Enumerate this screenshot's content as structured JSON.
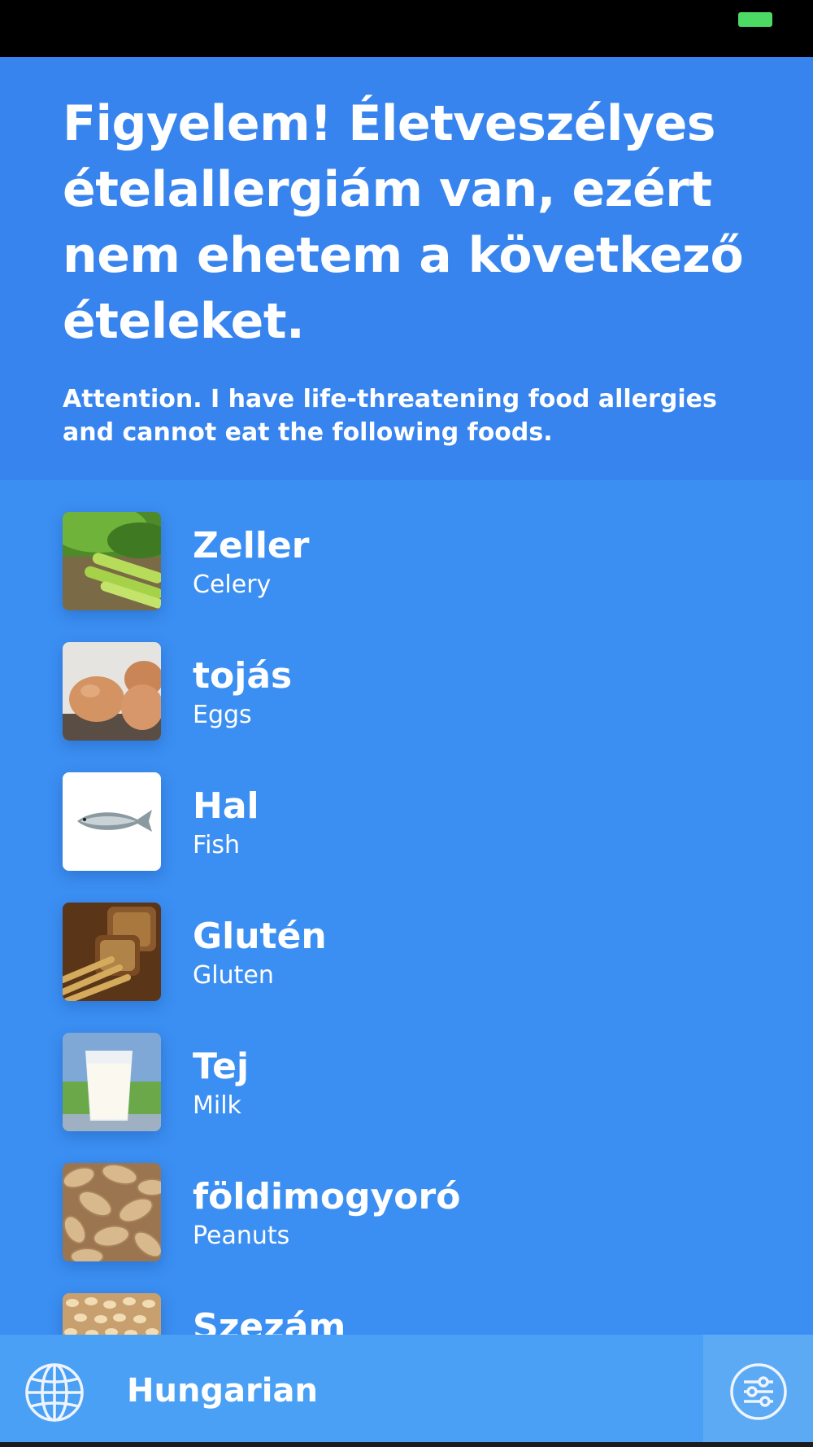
{
  "header": {
    "title": "Figyelem! Életveszélyes ételallergiám van, ezért nem ehetem a következő ételeket.",
    "subtitle": "Attention. I have life-threatening food allergies and cannot eat the following foods."
  },
  "items": [
    {
      "name": "Zeller",
      "translation": "Celery",
      "icon": "celery-image"
    },
    {
      "name": "tojás",
      "translation": "Eggs",
      "icon": "eggs-image"
    },
    {
      "name": "Hal",
      "translation": "Fish",
      "icon": "fish-image"
    },
    {
      "name": "Glutén",
      "translation": "Gluten",
      "icon": "bread-image"
    },
    {
      "name": "Tej",
      "translation": "Milk",
      "icon": "milk-image"
    },
    {
      "name": "földimogyoró",
      "translation": "Peanuts",
      "icon": "peanuts-image"
    },
    {
      "name": "Szezám",
      "translation": "",
      "icon": "sesame-image"
    }
  ],
  "bottom_bar": {
    "language": "Hungarian",
    "language_icon": "globe-icon",
    "settings_icon": "sliders-icon"
  },
  "colors": {
    "background": "#3b8ff2",
    "header": "#3784ef",
    "bottom_bar": "#4aa0f5",
    "battery": "#4cd964"
  }
}
